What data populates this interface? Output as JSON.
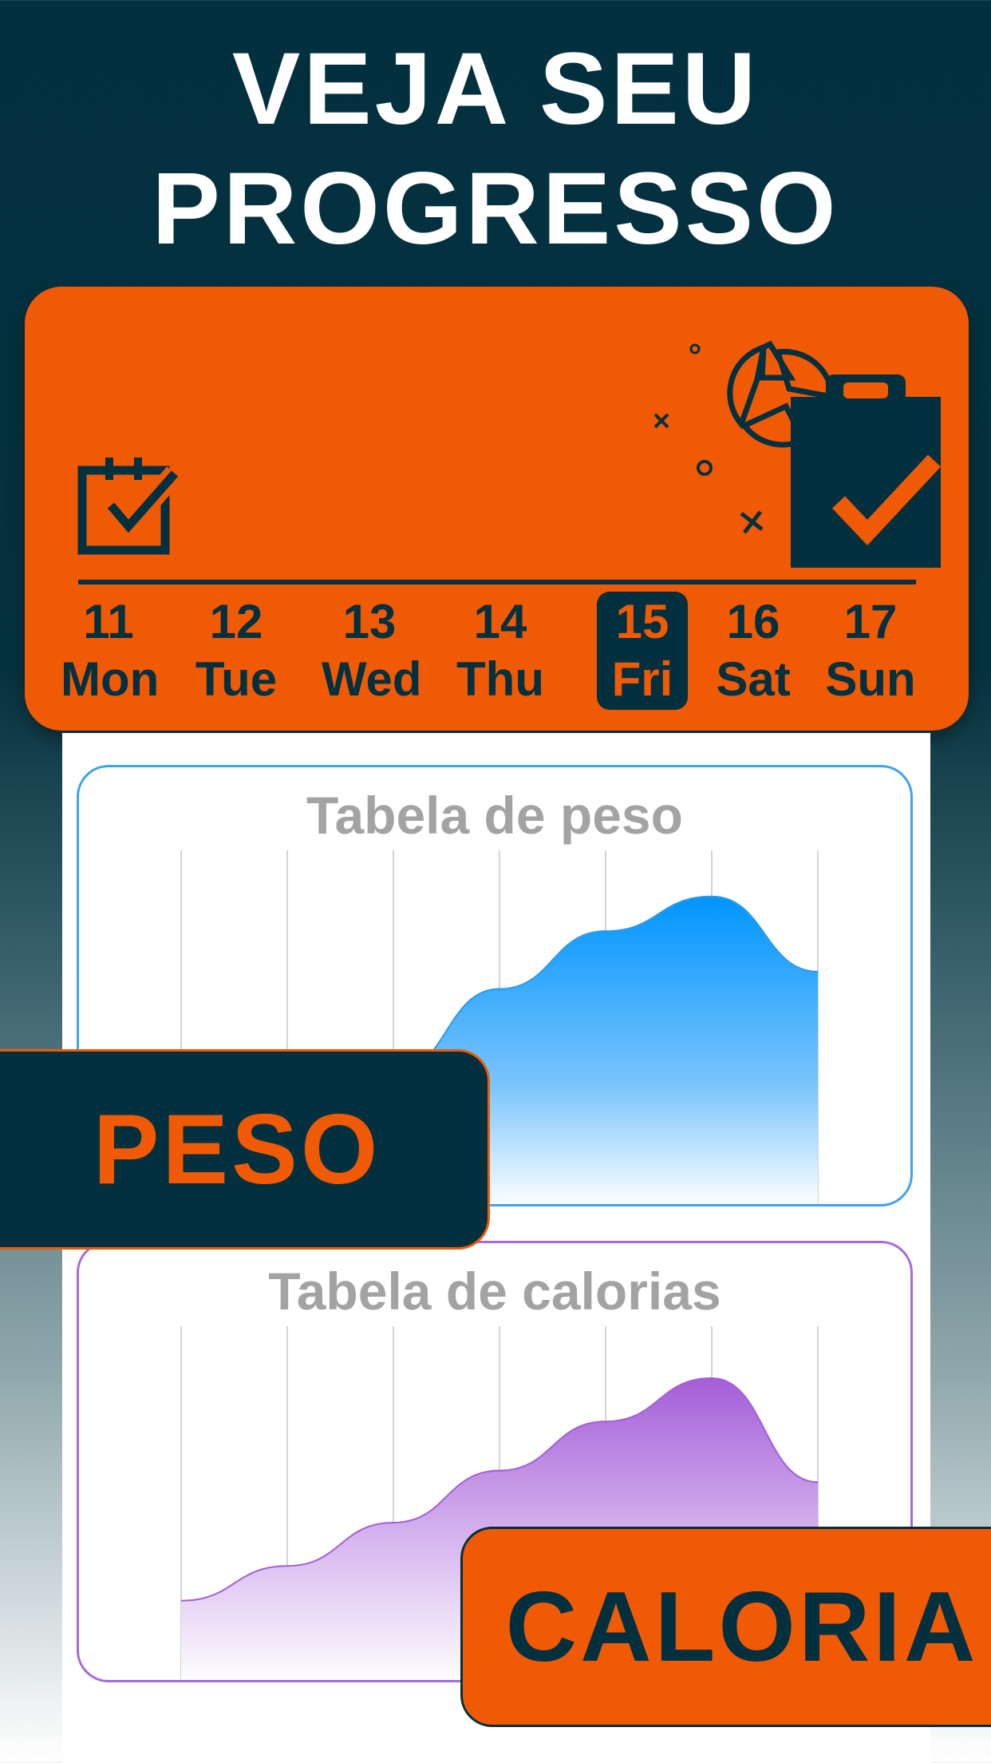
{
  "headline": {
    "line1": "VEJA SEU",
    "line2": "PROGRESSO"
  },
  "colors": {
    "navy": "#03303f",
    "orange": "#f05a05",
    "weight_blue": "#0095ff",
    "calorie_purple": "#a45ed8"
  },
  "calendar": {
    "days": [
      {
        "num": "11",
        "name": "Mon"
      },
      {
        "num": "12",
        "name": "Tue"
      },
      {
        "num": "13",
        "name": "Wed"
      },
      {
        "num": "14",
        "name": "Thu"
      },
      {
        "num": "15",
        "name": "Fri",
        "selected": true
      },
      {
        "num": "16",
        "name": "Sat"
      },
      {
        "num": "17",
        "name": "Sun"
      }
    ],
    "icons": [
      "calendar-check-icon",
      "clipboard-check-icon",
      "pie-chart-icon"
    ]
  },
  "charts": {
    "weight": {
      "title": "Tabela de peso",
      "badge": "PESO"
    },
    "calories": {
      "title": "Tabela de calorias",
      "badge": "CALORIA"
    }
  },
  "chart_data": [
    {
      "type": "area",
      "title": "Tabela de peso",
      "x": [
        1,
        2,
        3,
        4,
        5,
        6,
        7
      ],
      "values": [
        0.03,
        0.12,
        0.33,
        0.62,
        0.82,
        0.94,
        0.68
      ],
      "ylim": [
        0,
        1
      ],
      "grid": true
    },
    {
      "type": "area",
      "title": "Tabela de calorias",
      "x": [
        1,
        2,
        3,
        4,
        5,
        6,
        7
      ],
      "values": [
        0.15,
        0.27,
        0.42,
        0.6,
        0.77,
        0.92,
        0.56
      ],
      "ylim": [
        0,
        1
      ],
      "grid": true
    }
  ]
}
